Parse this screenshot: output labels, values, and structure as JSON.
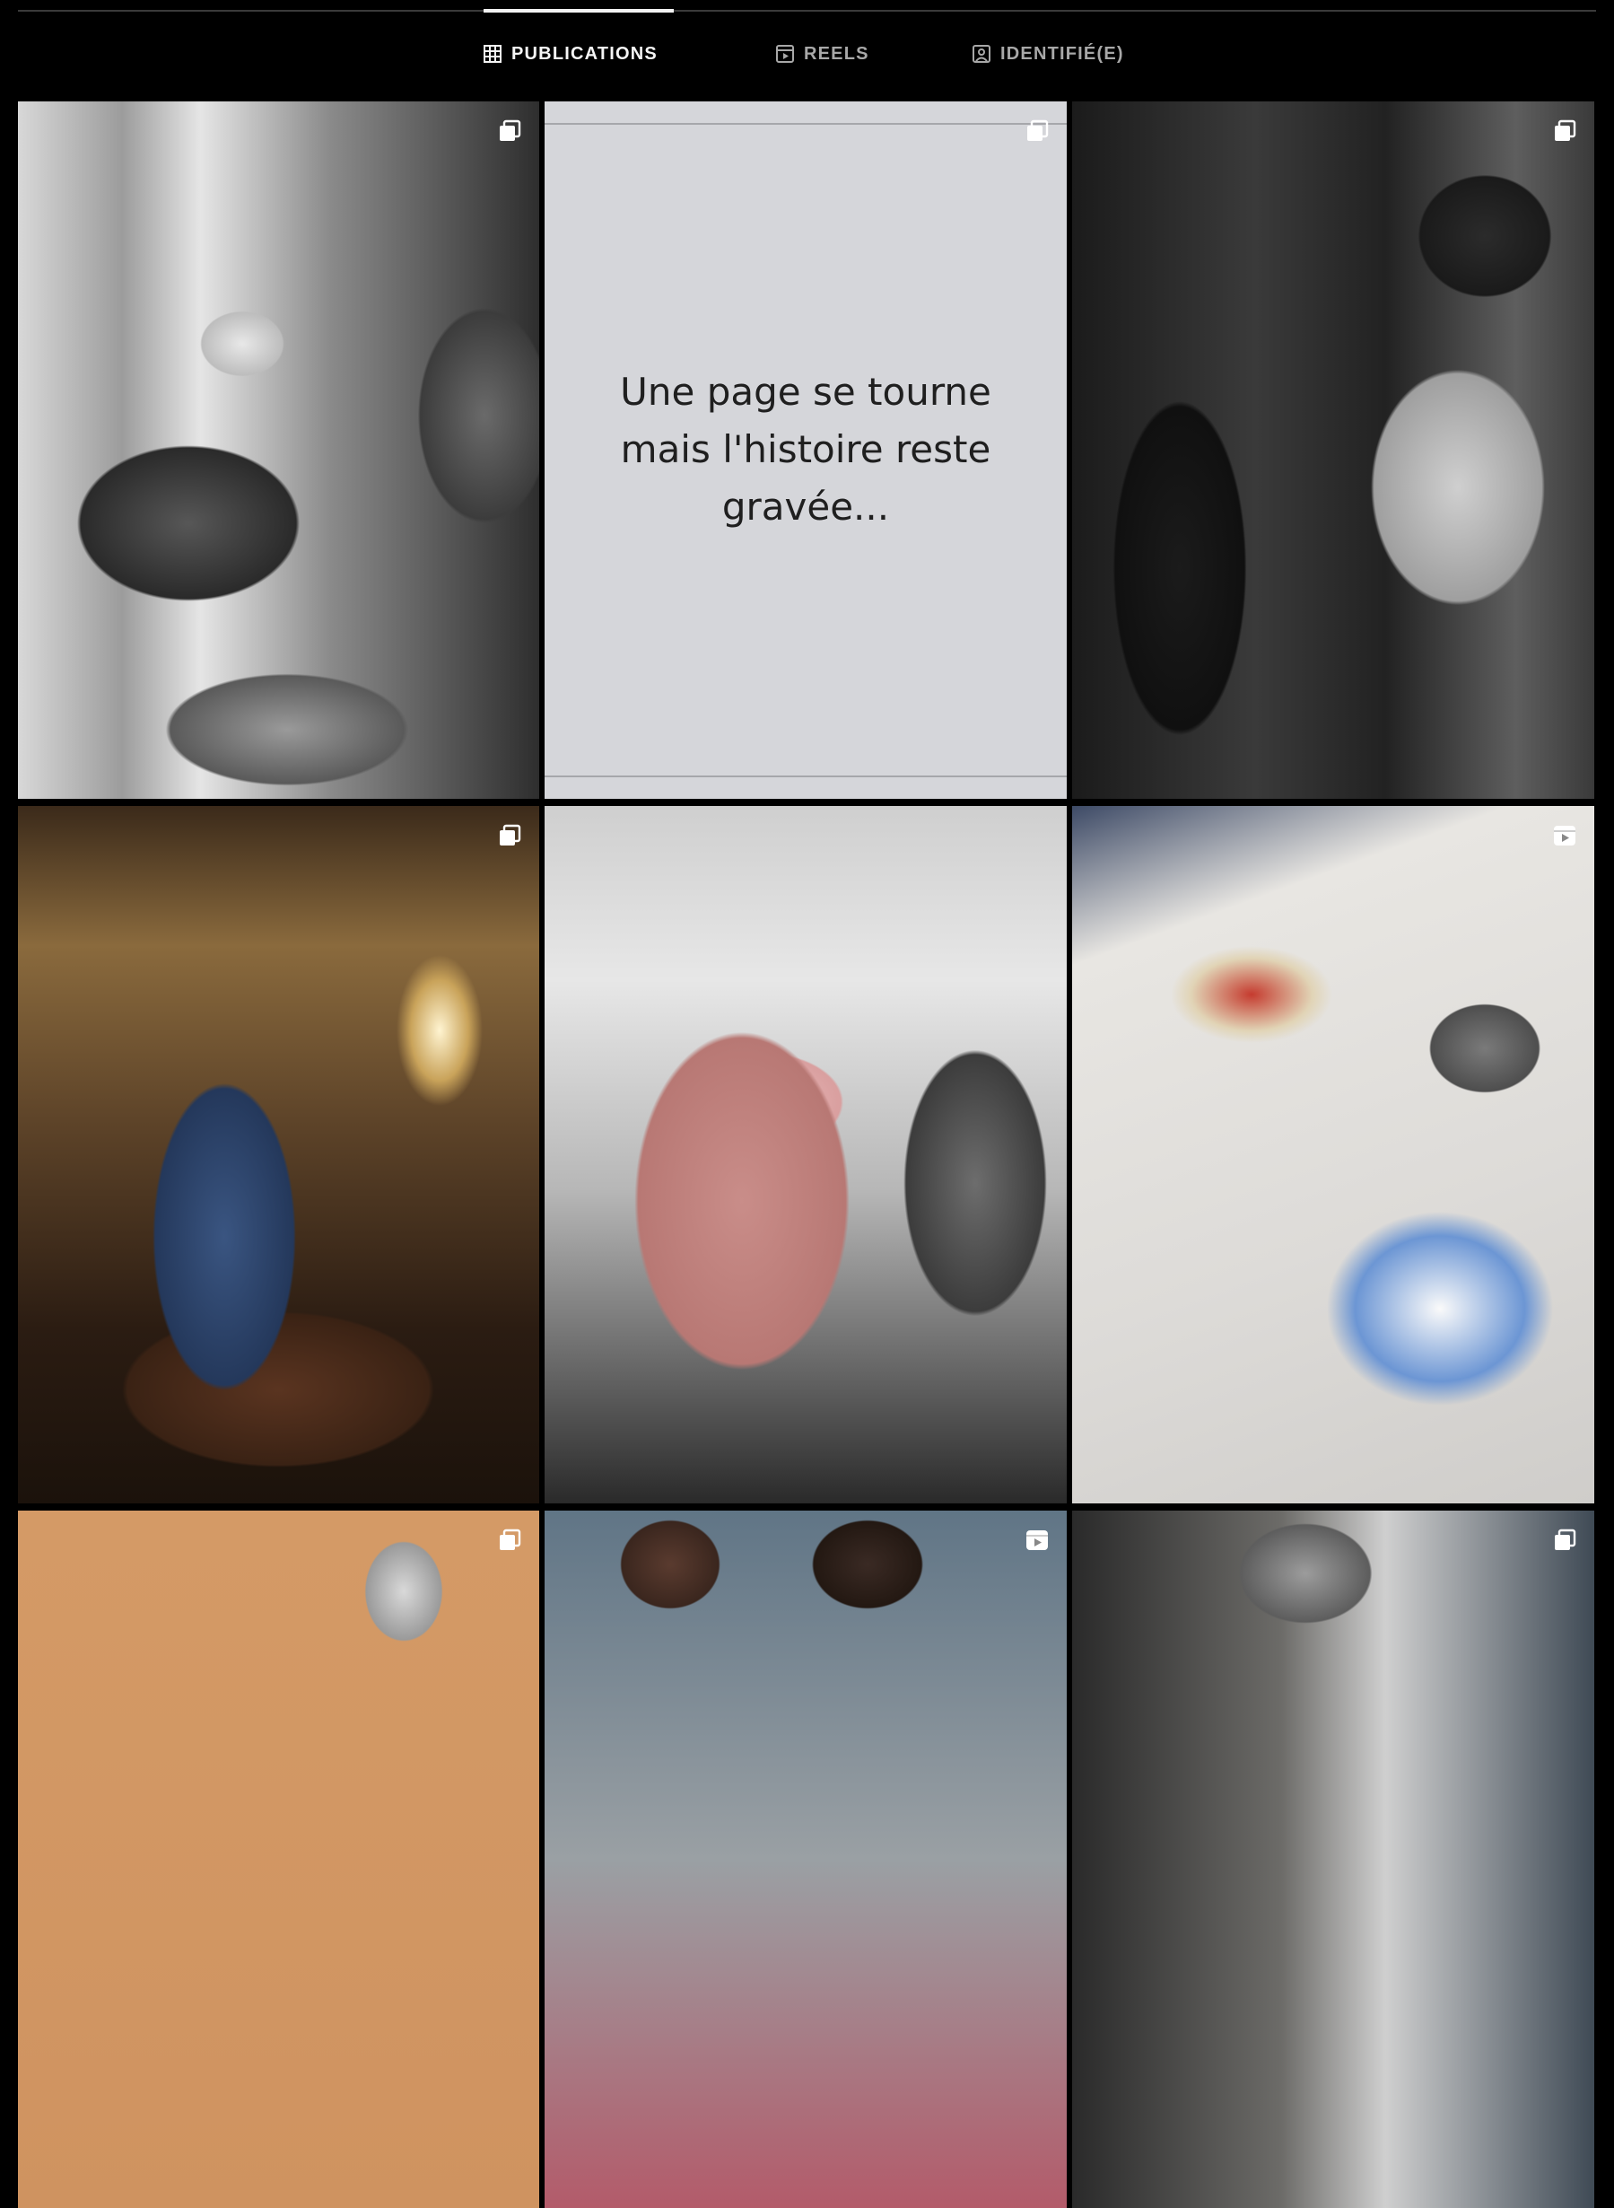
{
  "tabs": [
    {
      "label": "PUBLICATIONS",
      "icon": "grid-icon",
      "active": true
    },
    {
      "label": "REELS",
      "icon": "reels-icon",
      "active": false
    },
    {
      "label": "IDENTIFIÉ(E)",
      "icon": "tagged-icon",
      "active": false
    }
  ],
  "posts": [
    {
      "badge": "carousel-icon",
      "alt_text": ""
    },
    {
      "badge": "carousel-icon",
      "quote": "Une page se tourne mais l'histoire reste gravée..."
    },
    {
      "badge": "carousel-icon"
    },
    {
      "badge": "carousel-icon"
    },
    {
      "badge": "none"
    },
    {
      "badge": "reel-icon"
    },
    {
      "badge": "carousel-icon"
    },
    {
      "badge": "reel-icon"
    },
    {
      "badge": "carousel-icon"
    }
  ],
  "colors": {
    "background": "#000000",
    "tab_active": "#f5f5f5",
    "tab_inactive": "#a8a8a8",
    "card_bg": "#d5d6da"
  }
}
